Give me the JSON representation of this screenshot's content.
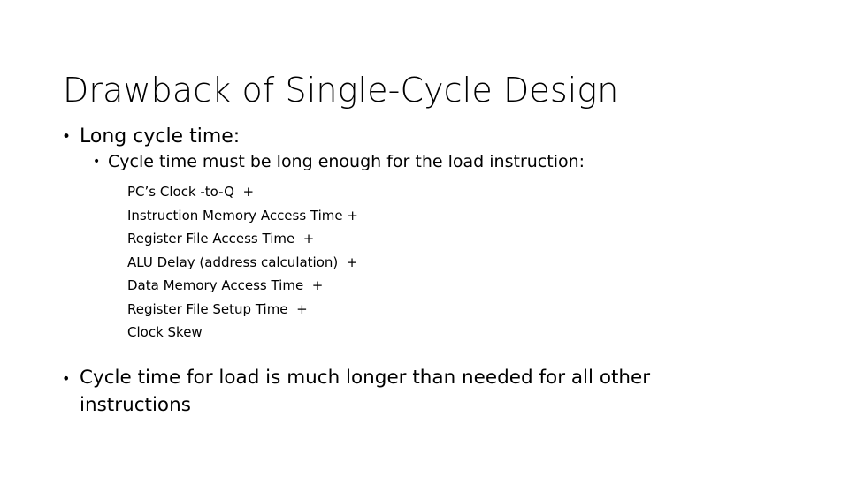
{
  "slide": {
    "title": "Drawback of Single-Cycle Design",
    "background_color": "#FFFFFF",
    "text_color": "#000000",
    "bullet_glyph": "•",
    "body": {
      "level1_first": {
        "text": "Long cycle time:",
        "bullet": "•"
      },
      "level2": {
        "text": "Cycle time must be long enough for the load instruction:",
        "bullet": "•"
      },
      "level3_lines": [
        "PC’s Clock -to-Q  +",
        "Instruction Memory Access Time +",
        "Register File Access Time  +",
        "ALU Delay (address calculation)  +",
        "Data Memory Access Time  +",
        "Register File Setup Time  +",
        "Clock Skew"
      ],
      "level1_last": {
        "text": "Cycle time for load is much longer than needed for all other instructions",
        "bullet": "•"
      }
    }
  }
}
